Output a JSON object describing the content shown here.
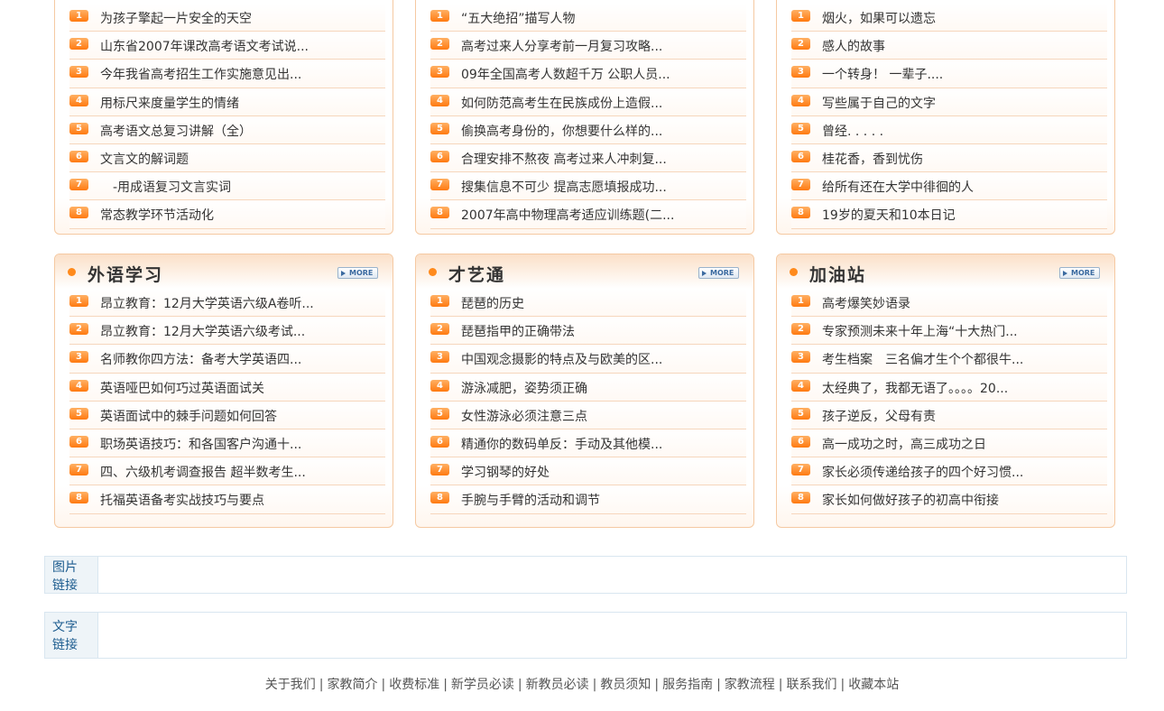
{
  "top_panels": [
    {
      "items": [
        {
          "num": "1",
          "text": "为孩子擎起一片安全的天空"
        },
        {
          "num": "2",
          "text": "山东省2007年课改高考语文考试说..."
        },
        {
          "num": "3",
          "text": "今年我省高考招生工作实施意见出..."
        },
        {
          "num": "4",
          "text": "用标尺来度量学生的情绪"
        },
        {
          "num": "5",
          "text": "高考语文总复习讲解（全）"
        },
        {
          "num": "6",
          "text": "文言文的解词题"
        },
        {
          "num": "7",
          "text": "　-用成语复习文言实词"
        },
        {
          "num": "8",
          "text": "常态教学环节活动化"
        }
      ]
    },
    {
      "items": [
        {
          "num": "1",
          "text": "“五大绝招”描写人物"
        },
        {
          "num": "2",
          "text": "高考过来人分享考前一月复习攻略..."
        },
        {
          "num": "3",
          "text": "09年全国高考人数超千万 公职人员..."
        },
        {
          "num": "4",
          "text": "如何防范高考生在民族成份上造假..."
        },
        {
          "num": "5",
          "text": "偷换高考身份的，你想要什么样的..."
        },
        {
          "num": "6",
          "text": "合理安排不熬夜 高考过来人冲刺复..."
        },
        {
          "num": "7",
          "text": "搜集信息不可少 提高志愿填报成功..."
        },
        {
          "num": "8",
          "text": "2007年高中物理高考适应训练题(二..."
        }
      ]
    },
    {
      "items": [
        {
          "num": "1",
          "text": "烟火，如果可以遗忘"
        },
        {
          "num": "2",
          "text": "感人的故事"
        },
        {
          "num": "3",
          "text": "一个转身！ 一辈子...."
        },
        {
          "num": "4",
          "text": "写些属于自己的文字"
        },
        {
          "num": "5",
          "text": "曾经. . . . ."
        },
        {
          "num": "6",
          "text": "桂花香，香到忧伤"
        },
        {
          "num": "7",
          "text": "给所有还在大学中徘徊的人"
        },
        {
          "num": "8",
          "text": "19岁的夏天和10本日记"
        }
      ]
    }
  ],
  "bottom_panels": [
    {
      "title": "外语学习",
      "more_label": "MORE",
      "items": [
        {
          "num": "1",
          "text": "昂立教育：12月大学英语六级A卷听..."
        },
        {
          "num": "2",
          "text": "昂立教育：12月大学英语六级考试..."
        },
        {
          "num": "3",
          "text": "名师教你四方法：备考大学英语四..."
        },
        {
          "num": "4",
          "text": "英语哑巴如何巧过英语面试关"
        },
        {
          "num": "5",
          "text": "英语面试中的棘手问题如何回答"
        },
        {
          "num": "6",
          "text": "职场英语技巧：和各国客户沟通十..."
        },
        {
          "num": "7",
          "text": "四、六级机考调查报告 超半数考生..."
        },
        {
          "num": "8",
          "text": "托福英语备考实战技巧与要点"
        }
      ]
    },
    {
      "title": "才艺通",
      "more_label": "MORE",
      "items": [
        {
          "num": "1",
          "text": "琵琶的历史"
        },
        {
          "num": "2",
          "text": "琵琶指甲的正确带法"
        },
        {
          "num": "3",
          "text": "中国观念摄影的特点及与欧美的区..."
        },
        {
          "num": "4",
          "text": "游泳减肥，姿势须正确"
        },
        {
          "num": "5",
          "text": "女性游泳必须注意三点"
        },
        {
          "num": "6",
          "text": "精通你的数码单反：手动及其他模..."
        },
        {
          "num": "7",
          "text": "学习钢琴的好处"
        },
        {
          "num": "8",
          "text": "手腕与手臂的活动和调节"
        }
      ]
    },
    {
      "title": "加油站",
      "more_label": "MORE",
      "items": [
        {
          "num": "1",
          "text": "高考爆笑妙语录"
        },
        {
          "num": "2",
          "text": "专家预测未来十年上海“十大热门..."
        },
        {
          "num": "3",
          "text": "考生档案　三名偏才生个个都很牛..."
        },
        {
          "num": "4",
          "text": "太经典了，我都无语了。。。。20..."
        },
        {
          "num": "5",
          "text": "孩子逆反，父母有责"
        },
        {
          "num": "6",
          "text": "高一成功之时，高三成功之日"
        },
        {
          "num": "7",
          "text": "家长必须传递给孩子的四个好习惯..."
        },
        {
          "num": "8",
          "text": "家长如何做好孩子的初高中衔接"
        }
      ]
    }
  ],
  "image_links": {
    "label_line1": "图片",
    "label_line2": "链接"
  },
  "text_links": {
    "label_line1": "文字",
    "label_line2": "链接"
  },
  "footer": {
    "links": [
      "关于我们",
      "家教简介",
      "收费标准",
      "新学员必读",
      "新教员必读",
      "教员须知",
      "服务指南",
      "家教流程",
      "联系我们",
      "收藏本站"
    ],
    "separator": "|"
  },
  "colors": {
    "accent": "#ff7a10",
    "panel_border": "#f5c9a2",
    "link_label": "#1d5c8f"
  }
}
